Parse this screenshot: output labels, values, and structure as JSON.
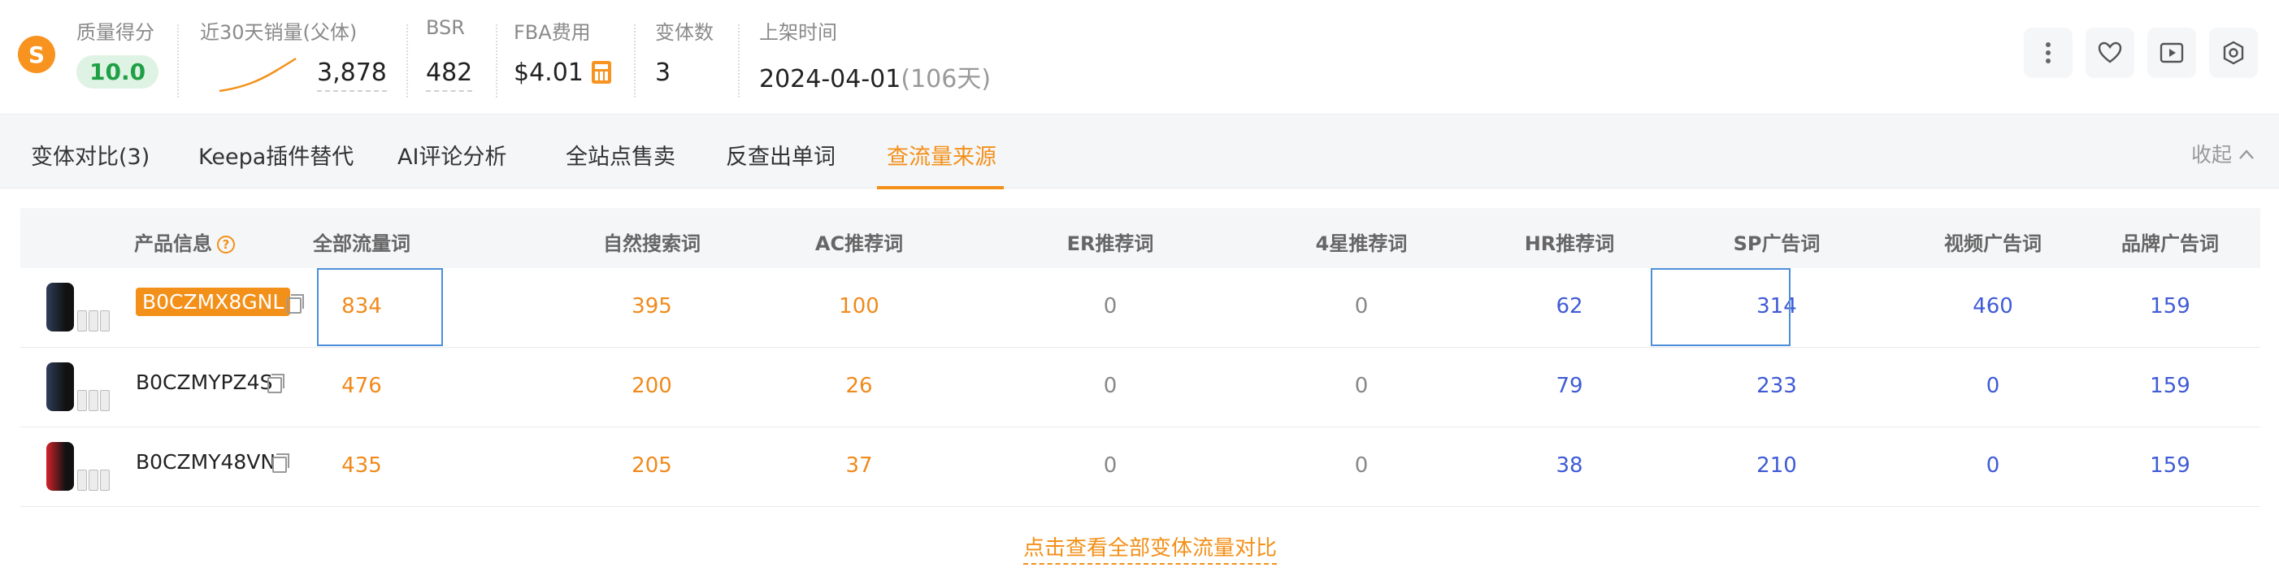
{
  "stats": {
    "quality": {
      "label": "质量得分",
      "value": "10.0"
    },
    "sales": {
      "label": "近30天销量(父体)",
      "value": "3,878"
    },
    "bsr": {
      "label": "BSR",
      "value": "482"
    },
    "fba": {
      "label": "FBA费用",
      "value": "$4.01"
    },
    "variants": {
      "label": "变体数",
      "value": "3"
    },
    "listed": {
      "label": "上架时间",
      "date": "2024-04-01",
      "days": "(106天)"
    }
  },
  "toolbar_icons": [
    "more-vertical-icon",
    "heart-icon",
    "video-icon",
    "settings-icon"
  ],
  "tabs": [
    {
      "label": "变体对比(3)"
    },
    {
      "label": "Keepa插件替代"
    },
    {
      "label": "AI评论分析"
    },
    {
      "label": "全站点售卖"
    },
    {
      "label": "反查出单词"
    },
    {
      "label": "查流量来源",
      "active": true
    }
  ],
  "collapse_label": "收起",
  "table": {
    "headers": [
      "产品信息",
      "全部流量词",
      "自然搜索词",
      "AC推荐词",
      "ER推荐词",
      "4星推荐词",
      "HR推荐词",
      "SP广告词",
      "视频广告词",
      "品牌广告词"
    ],
    "rows": [
      {
        "asin": "B0CZMX8GNL",
        "color": "#2f3e5a",
        "values": [
          "834",
          "395",
          "100",
          "0",
          "0",
          "62",
          "314",
          "460",
          "159"
        ]
      },
      {
        "asin": "B0CZMYPZ4S",
        "color": "#2f3e5a",
        "values": [
          "476",
          "200",
          "26",
          "0",
          "0",
          "79",
          "233",
          "0",
          "159"
        ]
      },
      {
        "asin": "B0CZMY48VN",
        "color": "#d2232a",
        "values": [
          "435",
          "205",
          "37",
          "0",
          "0",
          "38",
          "210",
          "0",
          "159"
        ]
      }
    ]
  },
  "footer_link": "点击查看全部变体流量对比",
  "colors": {
    "accent": "#f39019",
    "blue": "#3f5bd6",
    "green": "#1fa045"
  }
}
